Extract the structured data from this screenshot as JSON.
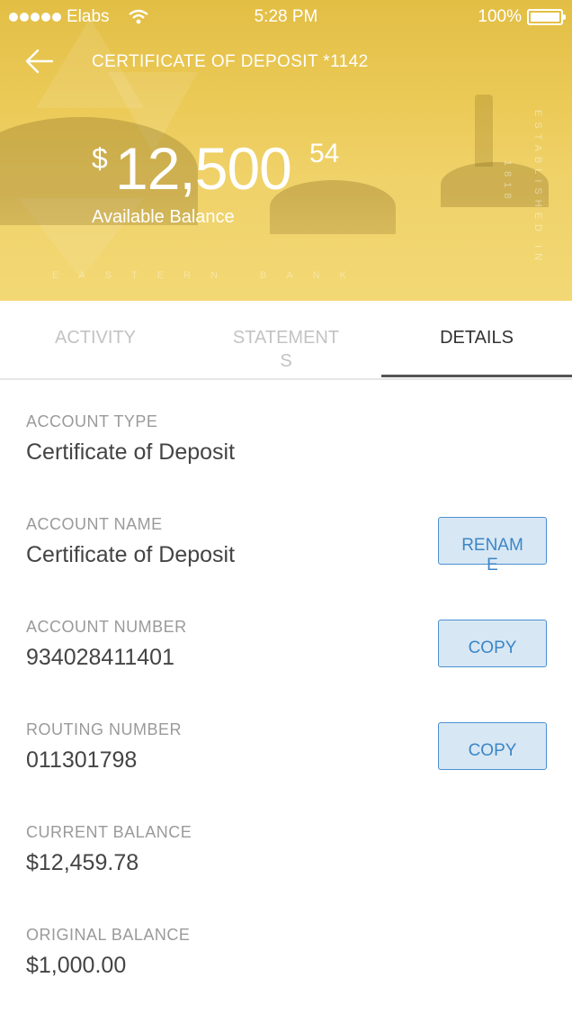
{
  "status_bar": {
    "carrier": "Elabs",
    "time": "5:28 PM",
    "battery": "100%"
  },
  "header": {
    "title": "CERTIFICATE OF DEPOSIT *1142",
    "balance_currency": "$",
    "balance_main": "12,500",
    "balance_cents": "54",
    "balance_label": "Available Balance",
    "watermark": "EASTERN BANK",
    "side_text_1": "ESTABLISHED IN",
    "side_text_2": "1818"
  },
  "tabs": [
    {
      "label": "ACTIVITY",
      "active": false
    },
    {
      "label": "STATEMENTS",
      "active": false
    },
    {
      "label": "DETAILS",
      "active": true
    }
  ],
  "details": [
    {
      "label": "ACCOUNT TYPE",
      "value": "Certificate of Deposit"
    },
    {
      "label": "ACCOUNT NAME",
      "value": "Certificate of Deposit",
      "action": "RENAME"
    },
    {
      "label": "ACCOUNT NUMBER",
      "value": "934028411401",
      "action": "COPY"
    },
    {
      "label": "ROUTING NUMBER",
      "value": "011301798",
      "action": "COPY"
    },
    {
      "label": "CURRENT BALANCE",
      "value": "$12,459.78"
    },
    {
      "label": "ORIGINAL BALANCE",
      "value": "$1,000.00"
    }
  ],
  "colors": {
    "header_gold": "#e8c64f",
    "button_bg": "#d8e7f4",
    "button_border": "#4a90d0",
    "button_text": "#3b86c6"
  },
  "icons": [
    "signal-dots-icon",
    "wifi-icon",
    "battery-icon",
    "back-arrow-icon"
  ]
}
